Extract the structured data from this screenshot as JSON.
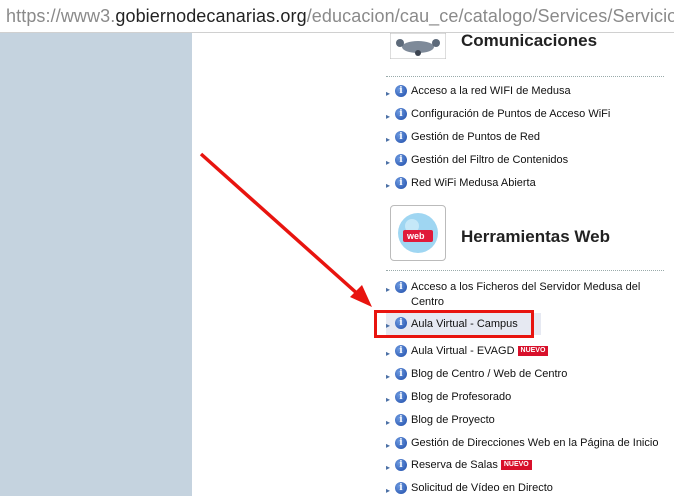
{
  "browser": {
    "url_prefix": "https://www3.",
    "url_domain": "gobiernodecanarias.org",
    "url_path": "/educacion/cau_ce/catalogo/Services/Servicios"
  },
  "sections": {
    "comunicaciones": {
      "title": "Comunicaciones",
      "items": [
        "Acceso a la red WIFI de Medusa",
        "Configuración de Puntos de Acceso WiFi",
        "Gestión de Puntos de Red",
        "Gestión del Filtro de Contenidos",
        "Red WiFi Medusa Abierta"
      ]
    },
    "herramientas": {
      "title": "Herramientas Web",
      "icon_label": "web",
      "items": [
        "Acceso a los Ficheros del Servidor Medusa del Centro",
        "Aula Virtual - Campus",
        "Aula Virtual - EVAGD",
        "Blog de Centro / Web de Centro",
        "Blog de Profesorado",
        "Blog de Proyecto",
        "Gestión de Direcciones Web en la Página de Inicio",
        "Reserva de Salas",
        "Solicitud de Vídeo en Directo"
      ],
      "badge": "NUEVO"
    }
  },
  "info_glyph": "i",
  "bullet_glyph": "▸",
  "colors": {
    "accent": "#e8140f",
    "sidebar": "#c5d3df",
    "badge": "#d8102b"
  }
}
